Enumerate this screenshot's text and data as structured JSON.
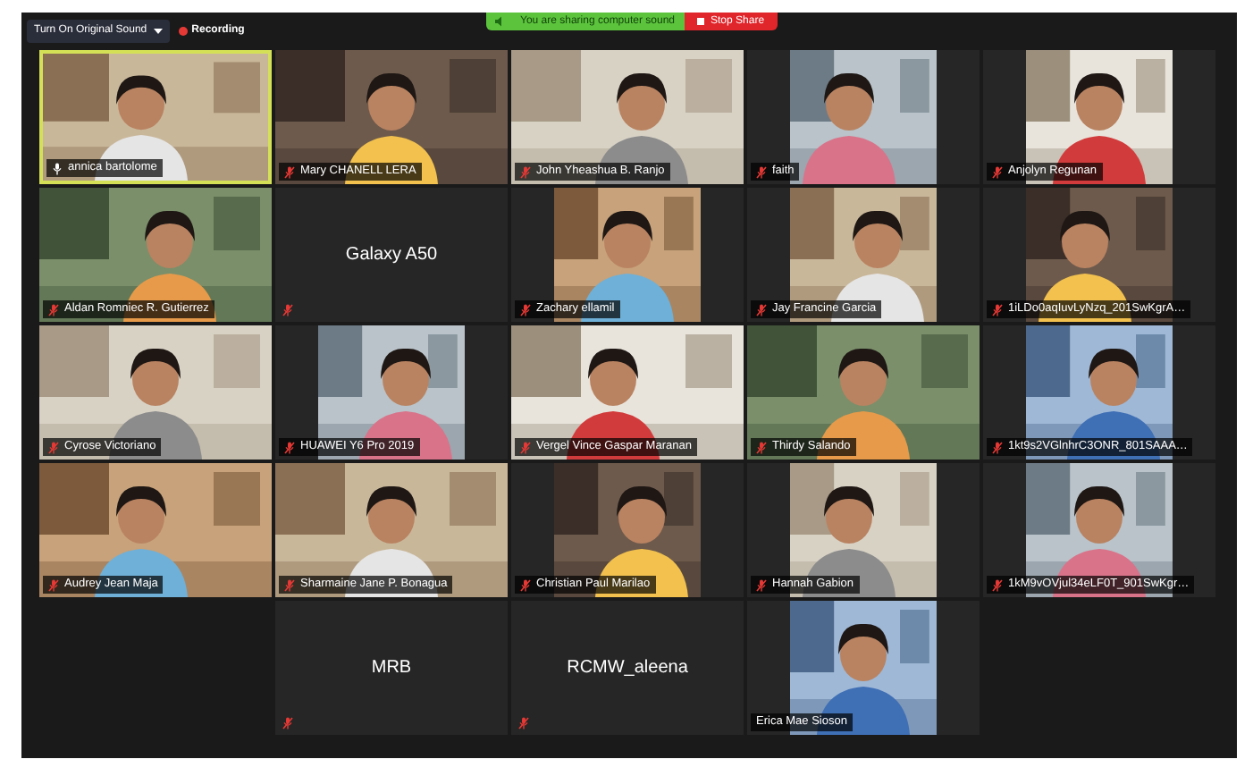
{
  "toolbar": {
    "original_sound_button": "Turn On Original Sound",
    "recording": "Recording"
  },
  "share_banner": {
    "message": "You are sharing computer sound",
    "stop_button": "Stop Share"
  },
  "tiles": [
    {
      "kind": "video",
      "name": "annica bartolome",
      "muted": false,
      "speaking": true,
      "portrait": false
    },
    {
      "kind": "video",
      "name": "Mary CHANELL LERA",
      "muted": true,
      "speaking": false,
      "portrait": false
    },
    {
      "kind": "video",
      "name": "John Yheashua B. Ranjo",
      "muted": true,
      "speaking": false,
      "portrait": false
    },
    {
      "kind": "video",
      "name": "faith",
      "muted": true,
      "speaking": false,
      "portrait": true
    },
    {
      "kind": "video",
      "name": "Anjolyn Regunan",
      "muted": true,
      "speaking": false,
      "portrait": true
    },
    {
      "kind": "video",
      "name": "Aldan Romniec R. Gutierrez",
      "muted": true,
      "speaking": false,
      "portrait": false
    },
    {
      "kind": "name",
      "name": "Galaxy A50",
      "muted": true,
      "speaking": false
    },
    {
      "kind": "video",
      "name": "Zachary ellamil",
      "muted": true,
      "speaking": false,
      "portrait": true
    },
    {
      "kind": "video",
      "name": "Jay Francine Garcia",
      "muted": true,
      "speaking": false,
      "portrait": true
    },
    {
      "kind": "video",
      "name": "1iLDo0aqIuvLyNzq_201SwKgrA…",
      "muted": true,
      "speaking": false,
      "portrait": true
    },
    {
      "kind": "video",
      "name": "Cyrose Victoriano",
      "muted": true,
      "speaking": false,
      "portrait": false
    },
    {
      "kind": "video",
      "name": "HUAWEI Y6 Pro 2019",
      "muted": true,
      "speaking": false,
      "portrait": true
    },
    {
      "kind": "video",
      "name": "Vergel Vince Gaspar Maranan",
      "muted": true,
      "speaking": false,
      "portrait": false
    },
    {
      "kind": "video",
      "name": "Thirdy Salando",
      "muted": true,
      "speaking": false,
      "portrait": false
    },
    {
      "kind": "video",
      "name": "1kt9s2VGlnhrC3ONR_801SAAA…",
      "muted": true,
      "speaking": false,
      "portrait": true
    },
    {
      "kind": "video",
      "name": "Audrey Jean Maja",
      "muted": true,
      "speaking": false,
      "portrait": false
    },
    {
      "kind": "video",
      "name": "Sharmaine Jane P. Bonagua",
      "muted": true,
      "speaking": false,
      "portrait": false
    },
    {
      "kind": "video",
      "name": "Christian Paul Marilao",
      "muted": true,
      "speaking": false,
      "portrait": true
    },
    {
      "kind": "video",
      "name": "Hannah Gabion",
      "muted": true,
      "speaking": false,
      "portrait": true
    },
    {
      "kind": "video",
      "name": "1kM9vOVjul34eLF0T_901SwKgr…",
      "muted": true,
      "speaking": false,
      "portrait": true
    },
    {
      "kind": "name",
      "name": "MRB",
      "muted": true,
      "speaking": false
    },
    {
      "kind": "name",
      "name": "RCMW_aleena",
      "muted": true,
      "speaking": false
    },
    {
      "kind": "video",
      "name": "Erica Mae Sioson",
      "muted": false,
      "speaking": false,
      "portrait": true
    }
  ]
}
